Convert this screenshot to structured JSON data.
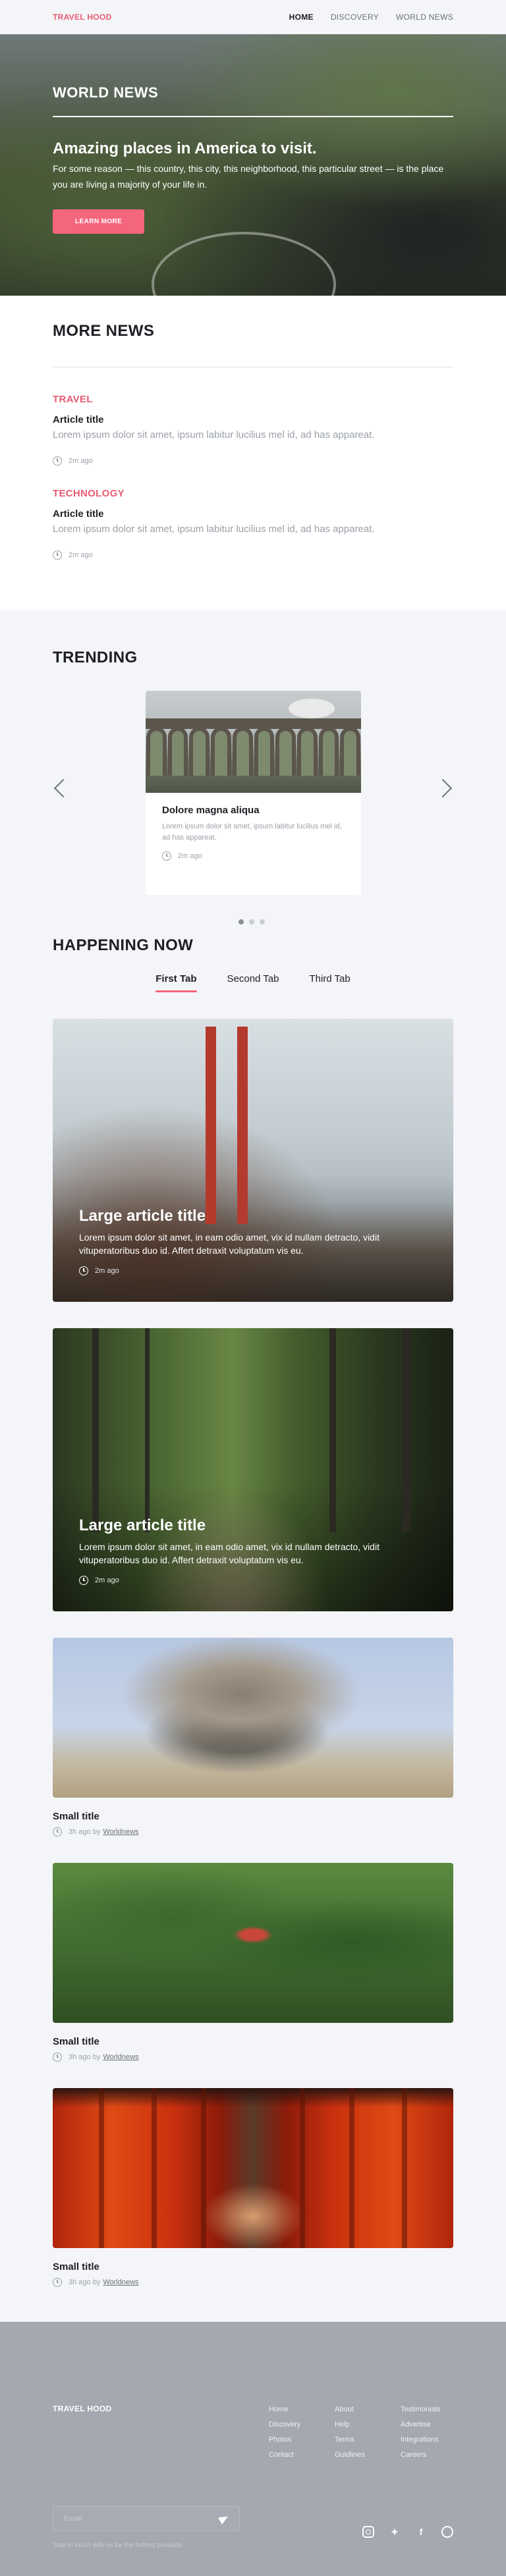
{
  "header": {
    "logo": "TRAVEL HOOD",
    "nav": [
      {
        "label": "HOME",
        "active": true
      },
      {
        "label": "DISCOVERY",
        "active": false
      },
      {
        "label": "WORLD NEWS",
        "active": false
      }
    ]
  },
  "hero": {
    "label": "WORLD NEWS",
    "title": "Amazing places in America to visit.",
    "text": "For some reason — this country, this city, this neighborhood, this particular street — is the place you are living a majority of your life in.",
    "button": "LEARN MORE"
  },
  "more_news": {
    "heading": "MORE NEWS",
    "items": [
      {
        "category": "TRAVEL",
        "title": "Article title",
        "text": "Lorem ipsum dolor sit amet, ipsum labitur lucilius mel id, ad has appareat.",
        "time": "2m ago"
      },
      {
        "category": "TECHNOLOGY",
        "title": "Article title",
        "text": "Lorem ipsum dolor sit amet, ipsum labitur lucilius mel id, ad has appareat.",
        "time": "2m ago"
      }
    ]
  },
  "trending": {
    "heading": "TRENDING",
    "card": {
      "title": "Dolore magna aliqua",
      "text": "Lorem ipsum dolor sit amet, ipsum labitur lucilius mel id, ad has appareat.",
      "time": "2m ago"
    },
    "slides": 3,
    "active_slide": 1
  },
  "happening": {
    "heading": "HAPPENING NOW",
    "tabs": [
      "First Tab",
      "Second Tab",
      "Third Tab"
    ],
    "active_tab": "First Tab",
    "large_articles": [
      {
        "title": "Large article title",
        "text": "Lorem ipsum dolor sit amet, in eam odio amet, vix id nullam detracto, vidit vituperatoribus duo id. Affert detraxit voluptatum vis eu.",
        "time": "2m ago"
      },
      {
        "title": "Large article title",
        "text": "Lorem ipsum dolor sit amet, in eam odio amet, vix id nullam detracto, vidit vituperatoribus duo id. Affert detraxit voluptatum vis eu.",
        "time": "2m ago"
      }
    ],
    "small_articles": [
      {
        "title": "Small title",
        "time": "3h ago by",
        "author": "Worldnews"
      },
      {
        "title": "Small title",
        "time": "3h ago by",
        "author": "Worldnews"
      },
      {
        "title": "Small title",
        "time": "3h ago by",
        "author": "Worldnews"
      }
    ]
  },
  "footer": {
    "logo": "TRAVEL HOOD",
    "columns": [
      [
        "Home",
        "Discovery",
        "Photos",
        "Contact"
      ],
      [
        "About",
        "Help",
        "Terms",
        "Guidlines"
      ],
      [
        "Testimonials",
        "Advertise",
        "Integrations",
        "Careers"
      ]
    ],
    "email_placeholder": "Email",
    "note": "Stay in touch with us for the hottest products",
    "socials": [
      "instagram-icon",
      "twitter-icon",
      "facebook-icon",
      "dribbble-icon"
    ]
  },
  "colors": {
    "accent": "#f4667d",
    "footer_bg": "#a3a8b1",
    "page_bg": "#f4f5f8"
  }
}
